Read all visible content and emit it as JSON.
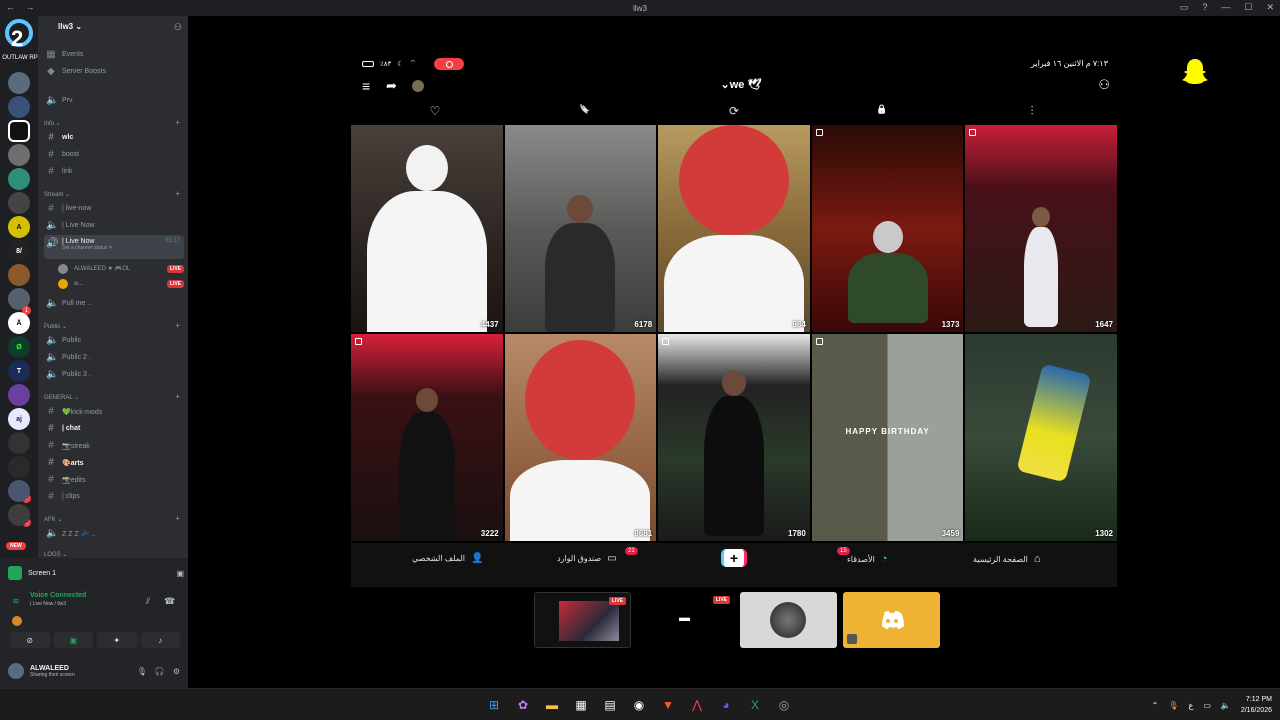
{
  "window": {
    "title": "llw3",
    "nav": "← →"
  },
  "server_list": {
    "logo_text": "OUTLAW RP",
    "new_label": "NEW",
    "badges": [
      "1",
      "7",
      "2"
    ]
  },
  "sidebar": {
    "server_name": "llw3 ⌄",
    "top_items": [
      {
        "icon": "calendar-icon",
        "label": "Events"
      },
      {
        "icon": "boost-icon",
        "label": "Server Boosts"
      }
    ],
    "channels_top": [
      {
        "type": "voice",
        "label": "Prv"
      }
    ],
    "categories": [
      {
        "name": "Info ⌄",
        "channels": [
          {
            "type": "text",
            "label": "wlc",
            "bright": true
          },
          {
            "type": "text",
            "label": "boost"
          },
          {
            "type": "text",
            "label": "link"
          }
        ]
      },
      {
        "name": "Stream ⌄",
        "channels": [
          {
            "type": "text",
            "label": "| live-now"
          },
          {
            "type": "voice",
            "label": "| Live Now"
          },
          {
            "type": "voice",
            "label": "| Live Now",
            "selected": true,
            "timer": "55:17",
            "sub": "Set a channel status ✎"
          }
        ]
      },
      {
        "name": "Public ⌄",
        "channels": [
          {
            "type": "voice",
            "label": "Public"
          },
          {
            "type": "voice",
            "label": "Public 2 ."
          },
          {
            "type": "voice",
            "label": "Public 3 ."
          }
        ]
      },
      {
        "name": "GENERAL ⌄",
        "channels": [
          {
            "type": "text",
            "label": "💚kick-mods"
          },
          {
            "type": "text",
            "label": "| chat",
            "bright": true
          },
          {
            "type": "text",
            "label": "📷streak"
          },
          {
            "type": "text",
            "label": "🎨arts",
            "bright": true
          },
          {
            "type": "text",
            "label": "📸edits"
          },
          {
            "type": "text",
            "label": "| clips"
          }
        ]
      },
      {
        "name": "AFK ⌄",
        "channels": [
          {
            "type": "voice",
            "label": "Z Z Z 💤 .."
          }
        ]
      },
      {
        "name": "LOGS ⌄",
        "channels": []
      }
    ],
    "voice_users": [
      {
        "name": "ALWALEED ★ 🎮OL",
        "live": "LIVE"
      },
      {
        "name": "w...",
        "live": "LIVE"
      }
    ],
    "pull_item": "Pull me ..",
    "live_tag": "LIVE"
  },
  "voice_panel": {
    "screen_label": "Screen 1",
    "connected": "Voice Connected",
    "channel": "| Live Now / llw3",
    "user_name": "ALWALEED",
    "user_status": "Sharing their screen"
  },
  "snapchat": {
    "status_time": "٧:١٣ م  الاثنين ١٦ فبراير",
    "status_battery": "٪٨٣",
    "brand": "we ",
    "tab_icons": [
      "heart-icon",
      "bookmark-icon",
      "repeat-icon",
      "lock-icon",
      "filter-icon"
    ],
    "tab_glyphs": [
      "♡",
      "🔖",
      "⟳",
      "🔒",
      "⫶"
    ],
    "grid_counts": [
      "4437",
      "6178",
      "984",
      "1373",
      "1647",
      "3222",
      "8681",
      "1780",
      "3459",
      "1302"
    ],
    "birthday_text": "HAPPY BIRTHDAY",
    "nav": {
      "home": "الصفحة الرئيسية",
      "friends": "الأصدقاء",
      "friends_badge": "15",
      "inbox": "صندوق الوارد",
      "inbox_badge": "21",
      "profile": "الملف الشخصي"
    },
    "plus_label": "+"
  },
  "streams": {
    "live_label": "LIVE"
  },
  "taskbar": {
    "time": "7:12 PM",
    "date": "2/16/2026",
    "lang": "ع"
  },
  "colors": {
    "discord_bg": "#2b2d31",
    "accent_green": "#23a55a",
    "live_red": "#da373c",
    "snap_yellow": "#fffc00",
    "discord_blurple": "#5865f2"
  }
}
